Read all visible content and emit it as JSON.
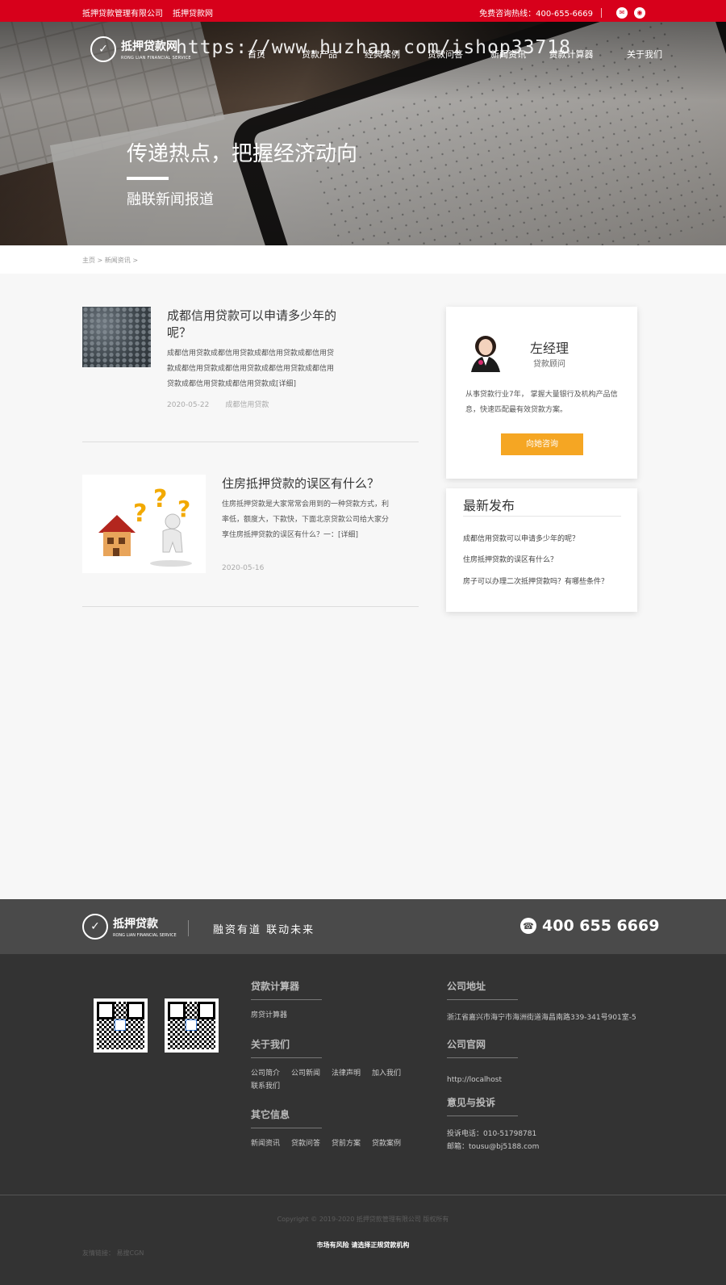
{
  "topbar": {
    "company": "抵押贷款管理有限公司",
    "site": "抵押贷款网",
    "hotline": "免费咨询热线：400-655-6669",
    "icons": [
      "wechat-icon",
      "weibo-icon"
    ]
  },
  "nav": {
    "logo_cn": "抵押贷款网",
    "logo_en": "RONG LIAN FINANCIAL SERVICE",
    "items": [
      "首页",
      "贷款产品",
      "经典案例",
      "贷款问答",
      "新闻资讯",
      "贷款计算器",
      "关于我们"
    ]
  },
  "watermark": "https://www.huzhan.com/ishop33718",
  "hero": {
    "title": "传递热点，把握经济动向",
    "subtitle": "融联新闻报道"
  },
  "breadcrumb": "主页 > 新闻资讯 >",
  "articles": [
    {
      "title": "成都信用贷款可以申请多少年的呢？",
      "desc": "成都信用贷款成都信用贷款成都信用贷款成都信用贷款成都信用贷款成都信用贷款成都信用贷款成都信用贷款成都信用贷款成都信用贷款成[详细]",
      "date": "2020-05-22",
      "tag": "成都信用贷款"
    },
    {
      "title": "住房抵押贷款的误区有什么？",
      "desc": "住房抵押贷款是大家常常会用到的一种贷款方式，利率低，额度大，下款快，下面北京贷款公司给大家分享住房抵押贷款的误区有什么？一：[详细]",
      "date": "2020-05-16",
      "tag": ""
    }
  ],
  "advisor": {
    "name": "左经理",
    "role": "贷款顾问",
    "intro": "从事贷款行业7年， 掌握大量银行及机构产品信息，快速匹配最有效贷款方案。",
    "button": "向她咨询"
  },
  "recent": {
    "title": "最新发布",
    "items": [
      "成都信用贷款可以申请多少年的呢？",
      "住房抵押贷款的误区有什么？",
      "房子可以办理二次抵押贷款吗？有哪些条件？"
    ]
  },
  "footer": {
    "logo_cn": "抵押贷款",
    "logo_en": "RONG LIAN FINANCIAL SERVICE",
    "slogan": "融资有道 联动未来",
    "phone": "400 655 6669",
    "calc": {
      "title": "贷款计算器",
      "links": [
        "房贷计算器"
      ]
    },
    "about": {
      "title": "关于我们",
      "links": [
        "公司简介",
        "公司新闻",
        "法律声明",
        "加入我们",
        "联系我们"
      ]
    },
    "other": {
      "title": "其它信息",
      "links": [
        "新闻资讯",
        "贷款问答",
        "贷前方案",
        "贷款案例"
      ]
    },
    "address": {
      "title": "公司地址",
      "text": "浙江省嘉兴市海宁市海洲街道海昌南路339-341号901室-5"
    },
    "website": {
      "title": "公司官网",
      "text": "http://localhost"
    },
    "complaint": {
      "title": "意见与投诉",
      "phone": "投诉电话：010-51798781",
      "email": "邮箱：tousu@bj5188.com"
    },
    "copyright": "Copyright © 2019-2020  抵押贷款管理有限公司 版权所有",
    "risk": "市场有风险 请选择正规贷款机构",
    "friend": "友情链接：   易搜CGN"
  }
}
